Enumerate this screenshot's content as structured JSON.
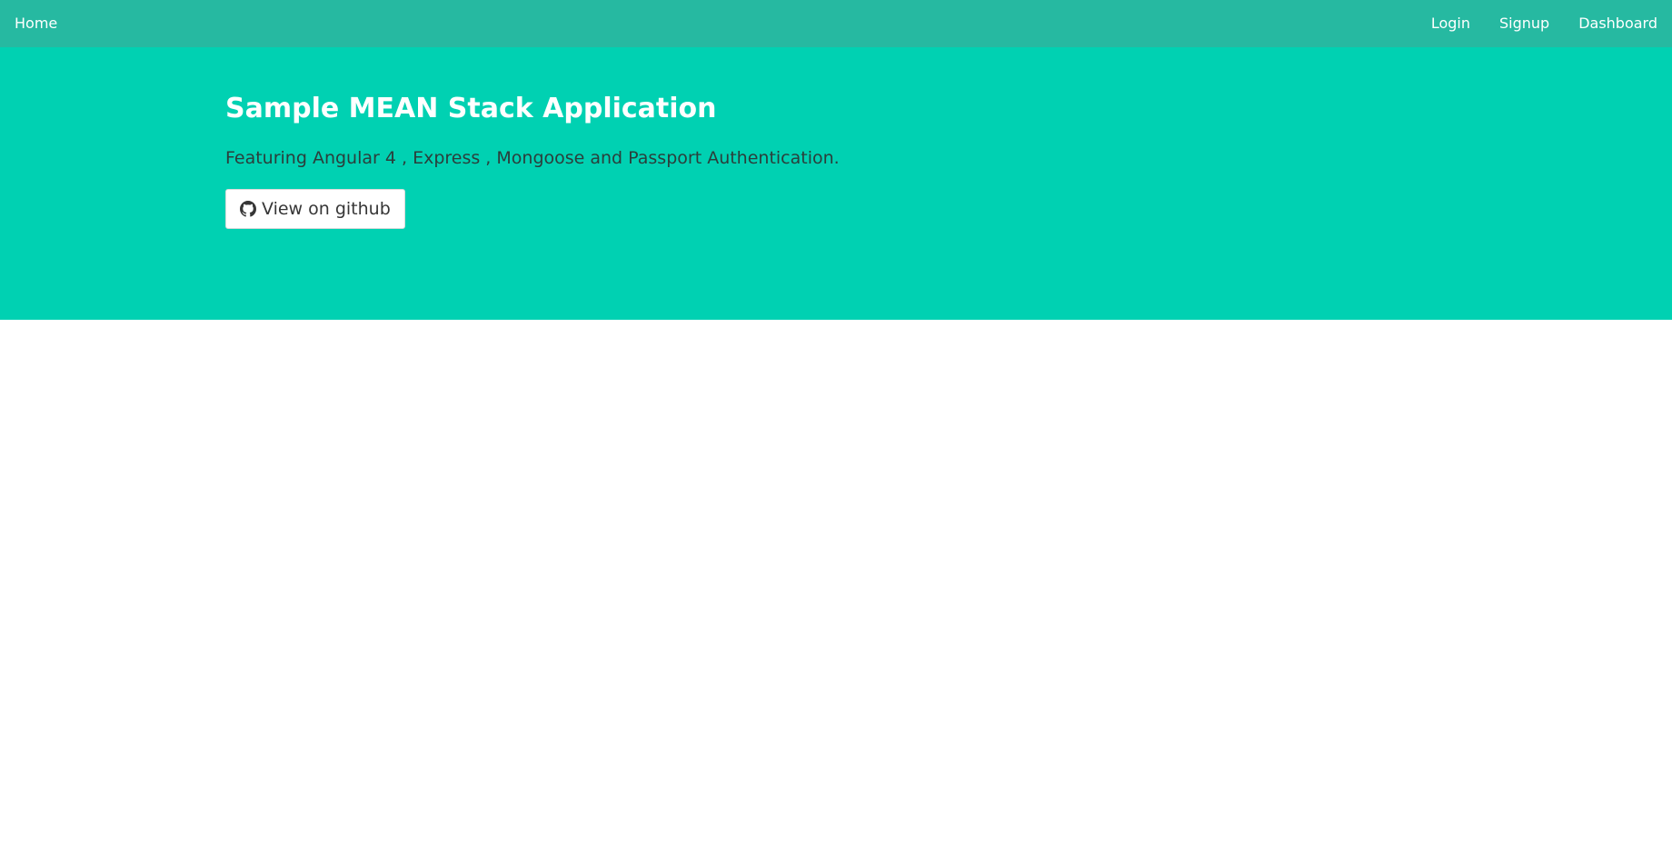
{
  "navbar": {
    "home_label": "Home",
    "links": [
      {
        "label": "Login"
      },
      {
        "label": "Signup"
      },
      {
        "label": "Dashboard"
      }
    ],
    "background_color": "#26b9a1"
  },
  "hero": {
    "title": "Sample MEAN Stack Application",
    "subtitle": "Featuring Angular 4 , Express , Mongoose and Passport Authentication.",
    "button": {
      "icon": "github-icon",
      "label": "View on github"
    },
    "background_color": "#00d1b2"
  }
}
